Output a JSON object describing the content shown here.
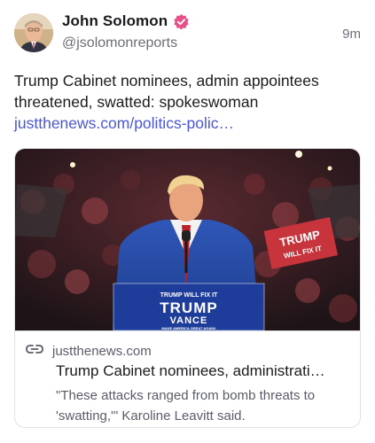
{
  "author": {
    "name": "John Solomon",
    "handle": "@jsolomonreports",
    "timestamp": "9m",
    "verified_color": "#e8508a"
  },
  "post": {
    "text": "Trump Cabinet nominees, admin appointees threatened, swatted: spokeswoman",
    "link_text": "justthenews.com/politics-polic…",
    "link_color": "#4a57d6"
  },
  "link_card": {
    "image_alt": "Photo of Donald Trump at a rally podium",
    "image_text": {
      "podium_banner": "TRUMP WILL FIX IT",
      "podium_name": "TRUMP",
      "podium_vp": "VANCE",
      "podium_slogan": "MAKE AMERICA GREAT AGAIN!",
      "sign_line1": "TRUMP",
      "sign_line2": "WILL FIX IT"
    },
    "domain": "justthenews.com",
    "title": "Trump Cabinet nominees, administrati…",
    "description": "\"These attacks ranged from bomb threats to 'swatting,'\" Karoline Leavitt said.",
    "link_icon": "link-icon"
  }
}
